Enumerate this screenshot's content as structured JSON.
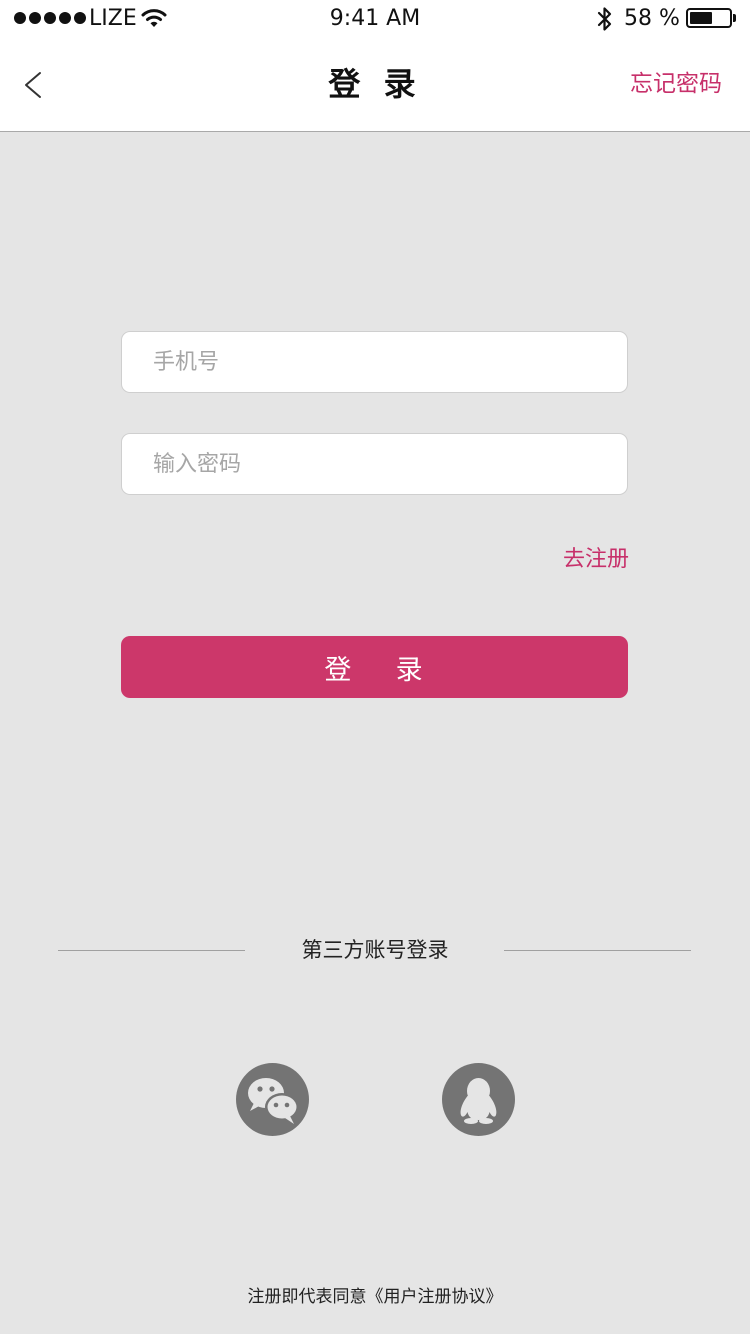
{
  "status_bar": {
    "carrier": "LIZE",
    "time": "9:41 AM",
    "battery_text": "58 %",
    "battery_level": 0.58
  },
  "nav": {
    "back_icon": "chevron-left-icon",
    "title": "登 录",
    "forgot_label": "忘记密码"
  },
  "form": {
    "phone_placeholder": "手机号",
    "phone_value": "",
    "password_placeholder": "输入密码",
    "password_value": "",
    "register_label": "去注册",
    "login_label": "登    录"
  },
  "third_party": {
    "label": "第三方账号登录",
    "icons": [
      "wechat-icon",
      "qq-icon"
    ]
  },
  "footer": {
    "agreement_prefix": "注册即代表同意",
    "agreement_link": "《用户注册协议》"
  },
  "colors": {
    "accent": "#cc376a",
    "link": "#c7306a",
    "background": "#e5e5e5",
    "icon_circle": "#747474"
  }
}
